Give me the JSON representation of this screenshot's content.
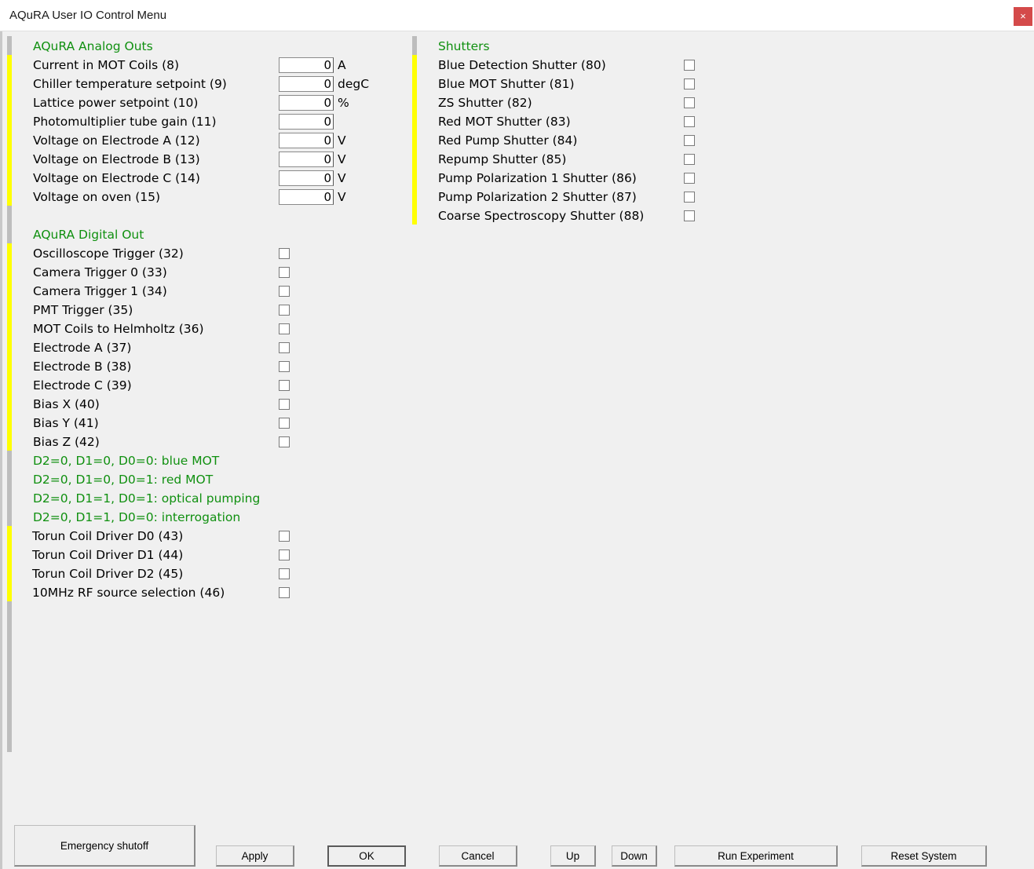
{
  "window": {
    "title": "AQuRA User IO Control Menu",
    "close_label": "×"
  },
  "analog": {
    "heading": "AQuRA Analog Outs",
    "items": [
      {
        "label": "Current in MOT Coils (8)",
        "value": "0",
        "unit": "A"
      },
      {
        "label": "Chiller temperature setpoint (9)",
        "value": "0",
        "unit": "degC"
      },
      {
        "label": "Lattice power setpoint (10)",
        "value": "0",
        "unit": "%"
      },
      {
        "label": "Photomultiplier tube gain (11)",
        "value": "0",
        "unit": ""
      },
      {
        "label": "Voltage on Electrode A (12)",
        "value": "0",
        "unit": "V"
      },
      {
        "label": "Voltage on Electrode B (13)",
        "value": "0",
        "unit": "V"
      },
      {
        "label": "Voltage on Electrode C (14)",
        "value": "0",
        "unit": "V"
      },
      {
        "label": "Voltage on oven (15)",
        "value": "0",
        "unit": "V"
      }
    ]
  },
  "digital": {
    "heading": "AQuRA Digital Out",
    "items": [
      {
        "label": "Oscilloscope Trigger (32)",
        "checked": false
      },
      {
        "label": "Camera Trigger 0 (33)",
        "checked": false
      },
      {
        "label": "Camera Trigger 1 (34)",
        "checked": false
      },
      {
        "label": "PMT Trigger (35)",
        "checked": false
      },
      {
        "label": "MOT Coils to Helmholtz (36)",
        "checked": false
      },
      {
        "label": "Electrode A (37)",
        "checked": false
      },
      {
        "label": "Electrode B (38)",
        "checked": false
      },
      {
        "label": "Electrode C (39)",
        "checked": false
      },
      {
        "label": "Bias X (40)",
        "checked": false
      },
      {
        "label": "Bias Y (41)",
        "checked": false
      },
      {
        "label": "Bias Z (42)",
        "checked": false
      }
    ],
    "modes": [
      "D2=0, D1=0, D0=0: blue MOT",
      "D2=0, D1=0, D0=1: red MOT",
      "D2=0, D1=1, D0=1: optical pumping",
      "D2=0, D1=1, D0=0: interrogation"
    ],
    "items2": [
      {
        "label": "Torun Coil Driver D0 (43)",
        "checked": false
      },
      {
        "label": "Torun Coil Driver D1 (44)",
        "checked": false
      },
      {
        "label": "Torun Coil Driver D2 (45)",
        "checked": false
      },
      {
        "label": "10MHz RF source selection (46)",
        "checked": false
      }
    ]
  },
  "shutters": {
    "heading": "Shutters",
    "items": [
      {
        "label": "Blue Detection Shutter (80)",
        "checked": false
      },
      {
        "label": "Blue MOT Shutter (81)",
        "checked": false
      },
      {
        "label": "ZS Shutter (82)",
        "checked": false
      },
      {
        "label": "Red MOT Shutter (83)",
        "checked": false
      },
      {
        "label": "Red Pump Shutter (84)",
        "checked": false
      },
      {
        "label": "Repump Shutter (85)",
        "checked": false
      },
      {
        "label": "Pump Polarization 1 Shutter (86)",
        "checked": false
      },
      {
        "label": "Pump Polarization 2 Shutter (87)",
        "checked": false
      },
      {
        "label": "Coarse Spectroscopy Shutter (88)",
        "checked": false
      }
    ]
  },
  "buttons": {
    "emergency": "Emergency shutoff",
    "apply": "Apply",
    "ok": "OK",
    "cancel": "Cancel",
    "up": "Up",
    "down": "Down",
    "run": "Run Experiment",
    "reset": "Reset System"
  },
  "colors": {
    "heading": "#109010",
    "active_marker": "#ffff00",
    "inactive_marker": "#bdbdbd",
    "close_button": "#d44a4a"
  }
}
